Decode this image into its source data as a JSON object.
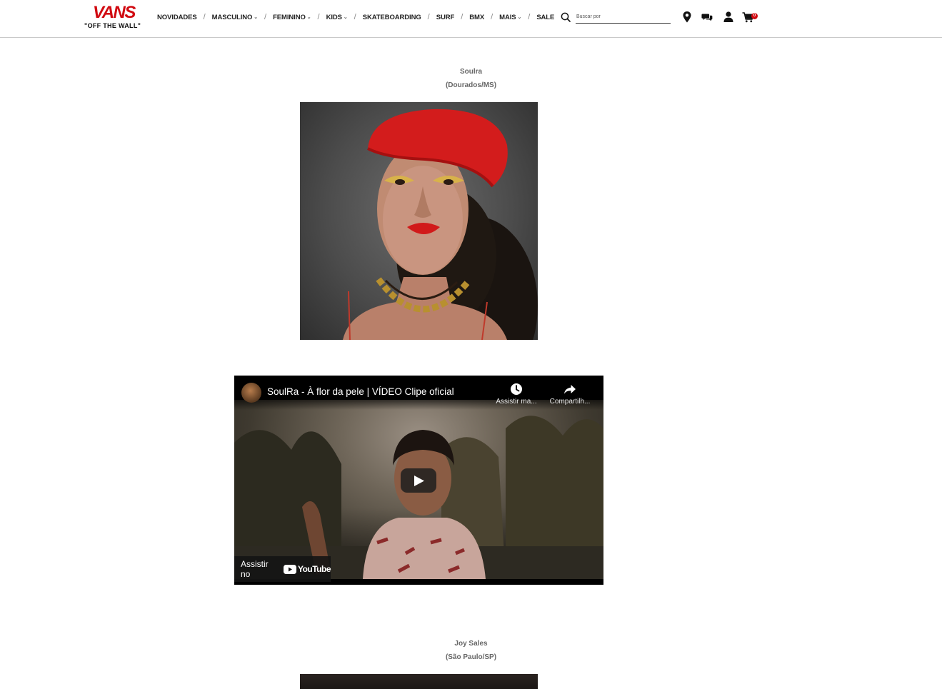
{
  "header": {
    "logo": {
      "brand": "VANS",
      "tagline": "\"OFF THE WALL\""
    },
    "nav": [
      {
        "label": "NOVIDADES",
        "dropdown": false
      },
      {
        "label": "MASCULINO",
        "dropdown": true
      },
      {
        "label": "FEMININO",
        "dropdown": true
      },
      {
        "label": "KIDS",
        "dropdown": true
      },
      {
        "label": "SKATEBOARDING",
        "dropdown": false
      },
      {
        "label": "SURF",
        "dropdown": false
      },
      {
        "label": "BMX",
        "dropdown": false
      },
      {
        "label": "MAIS",
        "dropdown": true
      },
      {
        "label": "SALE",
        "dropdown": false
      }
    ],
    "search": {
      "placeholder": "Buscar por",
      "value": ""
    },
    "icons": [
      "search-icon",
      "location-pin-icon",
      "chat-icon",
      "user-icon",
      "cart-icon"
    ],
    "cart_count": "0",
    "accent_color": "#d10a11"
  },
  "artists": [
    {
      "name": "Soulra",
      "location": "(Dourados/MS)"
    },
    {
      "name": "Joy Sales",
      "location": "(São Paulo/SP)"
    }
  ],
  "video": {
    "title": "SoulRa - À flor da pele | VÍDEO Clipe oficial",
    "watch_later": "Assistir ma...",
    "share": "Compartilh...",
    "watch_on": "Assistir no",
    "platform": "YouTube"
  }
}
